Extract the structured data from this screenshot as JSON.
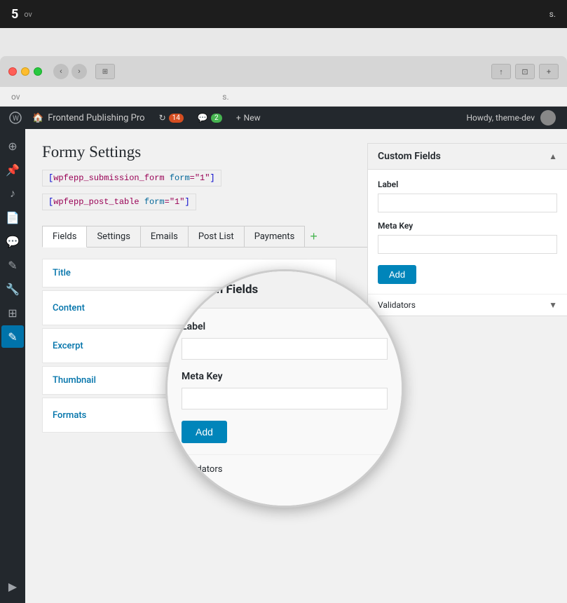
{
  "topBar": {
    "title": "5",
    "subtitle": "ov",
    "subtitleEnd": "s."
  },
  "browser": {
    "backLabel": "‹",
    "forwardLabel": "›",
    "newTabIcon": "⊞",
    "shareIcon": "↑",
    "expandIcon": "⊡",
    "plusIcon": "+"
  },
  "adminBar": {
    "wpLogo": "W",
    "siteName": "Frontend Publishing Pro",
    "updates": "14",
    "comments": "2",
    "newLabel": "New",
    "howdy": "Howdy, theme-dev"
  },
  "sidebar": {
    "icons": [
      "⊕",
      "📌",
      "🎵",
      "📄",
      "💬",
      "✏",
      "🔧",
      "⊞",
      "✏"
    ]
  },
  "page": {
    "title": "Formy Settings",
    "shortcode1": "[wpfepp_submission_form form=\"1\"]",
    "shortcode2": "[wpfepp_post_table form=\"1\"]"
  },
  "tabs": [
    {
      "label": "Fields",
      "active": true
    },
    {
      "label": "Settings",
      "active": false
    },
    {
      "label": "Emails",
      "active": false
    },
    {
      "label": "Post List",
      "active": false
    },
    {
      "label": "Payments",
      "active": false
    }
  ],
  "fields": [
    {
      "name": "Title",
      "hasExpand": false
    },
    {
      "name": "Content",
      "hasExpand": true
    },
    {
      "name": "Excerpt",
      "hasExpand": true
    },
    {
      "name": "Thumbnail",
      "hasExpand": false
    },
    {
      "name": "Formats",
      "hasExpand": true
    }
  ],
  "rightPanel": {
    "title": "Custom Fields",
    "labelField": "Label",
    "labelPlaceholder": "",
    "metaKeyField": "Meta Key",
    "metaKeyPlaceholder": "",
    "addButton": "Add",
    "validatorsLabel": "Validators"
  }
}
